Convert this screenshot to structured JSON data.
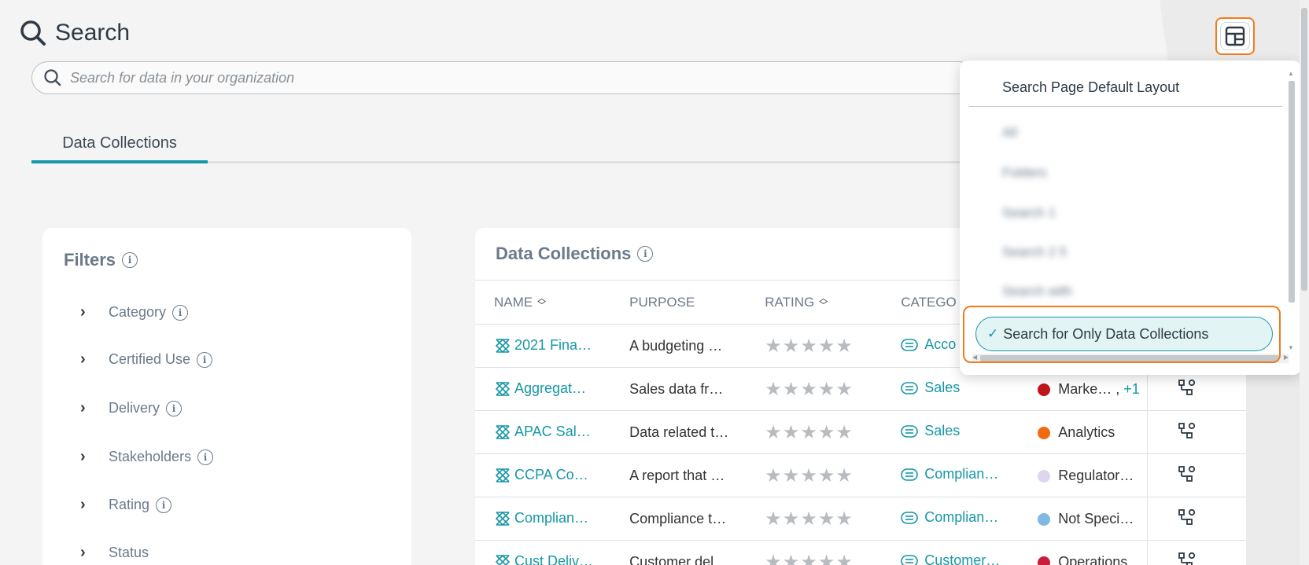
{
  "header": {
    "title": "Search"
  },
  "search": {
    "placeholder": "Search for data in your organization"
  },
  "tabs": [
    {
      "label": "Data Collections"
    }
  ],
  "filters": {
    "title": "Filters",
    "items": [
      "Category",
      "Certified Use",
      "Delivery",
      "Stakeholders",
      "Rating",
      "Status"
    ]
  },
  "collections": {
    "title": "Data Collections",
    "columns": {
      "name": "NAME",
      "purpose": "PURPOSE",
      "rating": "RATING",
      "category": "CATEGO"
    },
    "rows": [
      {
        "name": "2021 Fina…",
        "purpose": "A budgeting …",
        "category": "Acco",
        "tag": "",
        "tag_color": "",
        "extra": ""
      },
      {
        "name": "Aggregat…",
        "purpose": "Sales data fr…",
        "category": "Sales",
        "tag": "Marke… ,",
        "tag_color": "#c0141c",
        "extra": "+1"
      },
      {
        "name": "APAC Sal…",
        "purpose": "Data related t…",
        "category": "Sales",
        "tag": "Analytics",
        "tag_color": "#f26a10",
        "extra": ""
      },
      {
        "name": "CCPA Co…",
        "purpose": "A report that …",
        "category": "Complian…",
        "tag": "Regulator…",
        "tag_color": "#ddd6ee",
        "extra": ""
      },
      {
        "name": "Complian…",
        "purpose": "Compliance t…",
        "category": "Complian…",
        "tag": "Not Speci…",
        "tag_color": "#7fb8e0",
        "extra": ""
      },
      {
        "name": "Cust Deliv…",
        "purpose": "Customer del…",
        "category": "Customer…",
        "tag": "Operations",
        "tag_color": "#c81e3c",
        "extra": ""
      }
    ],
    "stars": "★★★★★"
  },
  "layout_menu": {
    "default_label": "Search Page Default Layout",
    "blurred_items": [
      "All",
      "Folders",
      "Search 1",
      "Search 2 5",
      "Search with"
    ],
    "selected_label": "Search for Only Data Collections",
    "check": "✓"
  },
  "colors": {
    "accent": "#1597a6",
    "highlight": "#f07c1e"
  }
}
